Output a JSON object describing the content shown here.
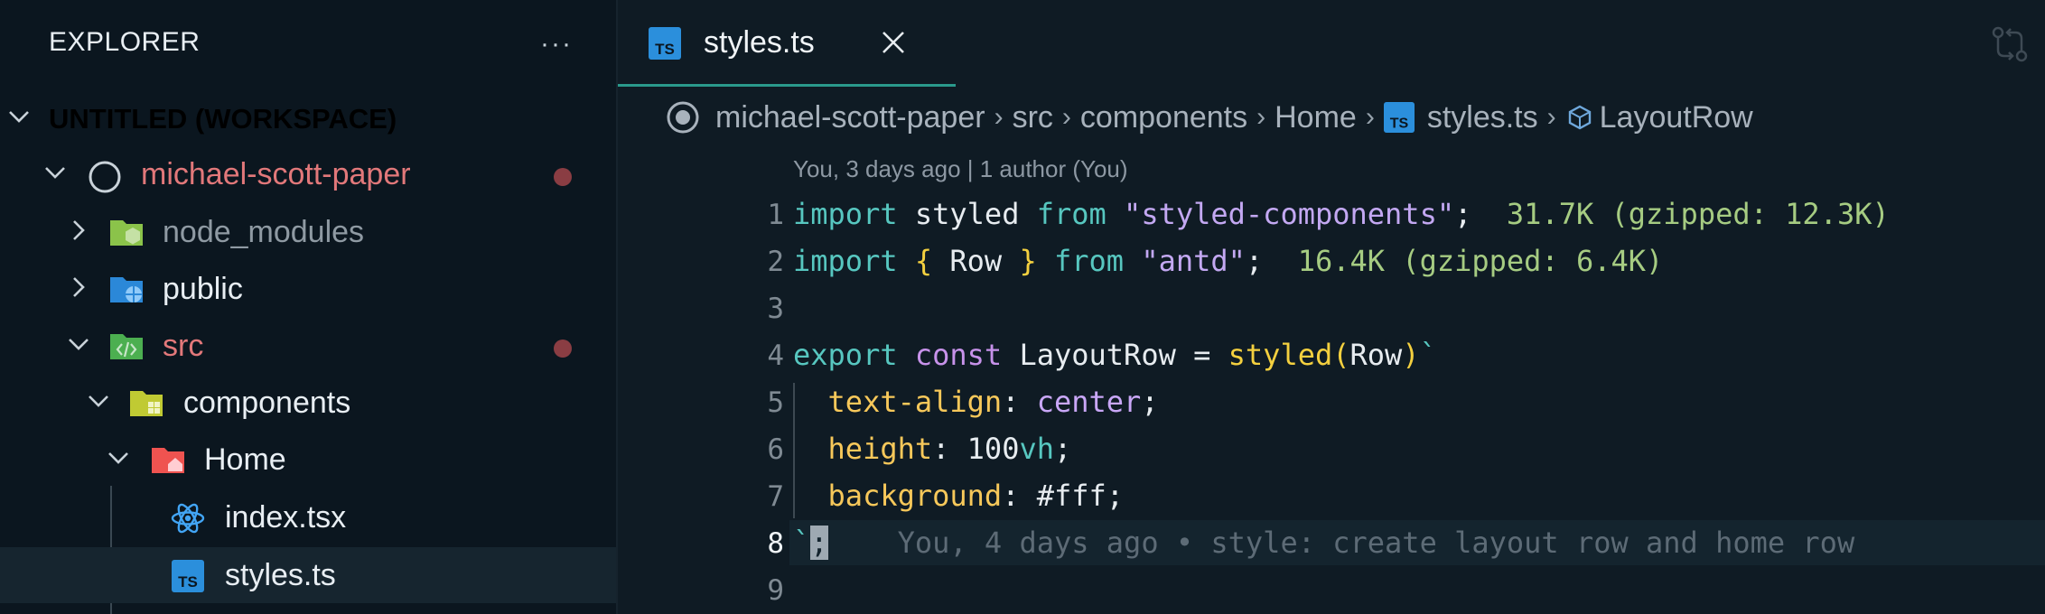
{
  "explorer": {
    "title": "EXPLORER",
    "more_label": "···",
    "tree": [
      {
        "label": "UNTITLED (WORKSPACE)",
        "color": "#e8eef3",
        "icon": "chevron-down-icon"
      },
      {
        "label": "michael-scott-paper",
        "color": "#e2787a",
        "icon": "repo-circle-icon",
        "modified": true
      },
      {
        "label": "node_modules",
        "color": "#8f9aa3",
        "icon": "folder-node-icon"
      },
      {
        "label": "public",
        "color": "#e8eef3",
        "icon": "folder-public-icon"
      },
      {
        "label": "src",
        "color": "#e2787a",
        "icon": "folder-src-icon",
        "modified": true
      },
      {
        "label": "components",
        "color": "#e8eef3",
        "icon": "folder-components-icon"
      },
      {
        "label": "Home",
        "color": "#e8eef3",
        "icon": "folder-home-icon"
      },
      {
        "label": "index.tsx",
        "color": "#e8eef3",
        "icon": "react-icon"
      },
      {
        "label": "styles.ts",
        "color": "#e8eef3",
        "icon": "typescript-file-icon",
        "selected": true
      }
    ]
  },
  "tab": {
    "label": "styles.ts",
    "close_label": "×",
    "badge": "TS"
  },
  "breadcrumb": {
    "items": [
      "michael-scott-paper",
      "src",
      "components",
      "Home",
      "styles.ts",
      "LayoutRow"
    ]
  },
  "codelens": "You, 3 days ago | 1 author (You)",
  "lines": [
    {
      "n": "1"
    },
    {
      "n": "2"
    },
    {
      "n": "3"
    },
    {
      "n": "4"
    },
    {
      "n": "5"
    },
    {
      "n": "6"
    },
    {
      "n": "7"
    },
    {
      "n": "8"
    },
    {
      "n": "9"
    }
  ],
  "code": {
    "l1": {
      "kw": "import",
      "id": " styled ",
      "from": "from",
      "str": "\"styled-components\"",
      "end": ";",
      "size": "31.7K (gzipped: 12.3K)"
    },
    "l2": {
      "kw": "import",
      "ob": "{",
      "id": " Row ",
      "cb": "}",
      "from": "from",
      "str": "\"antd\"",
      "end": ";",
      "size": "16.4K (gzipped: 6.4K)"
    },
    "l4": {
      "kw": "export",
      "kw2": "const",
      "id": " LayoutRow = ",
      "fn": "styled",
      "op": "(",
      "arg": "Row",
      "cp": ")",
      "tick": "`"
    },
    "l5": {
      "prop": "text-align",
      "colon": ": ",
      "val": "center",
      "end": ";"
    },
    "l6": {
      "prop": "height",
      "colon": ": ",
      "num": "100",
      "unit": "vh",
      "end": ";"
    },
    "l7": {
      "prop": "background",
      "colon": ": ",
      "val": "#fff",
      "end": ";"
    },
    "l8": {
      "tick": "`",
      "semi": ";",
      "blame": "You, 4 days ago • style: create layout row and home row"
    }
  }
}
